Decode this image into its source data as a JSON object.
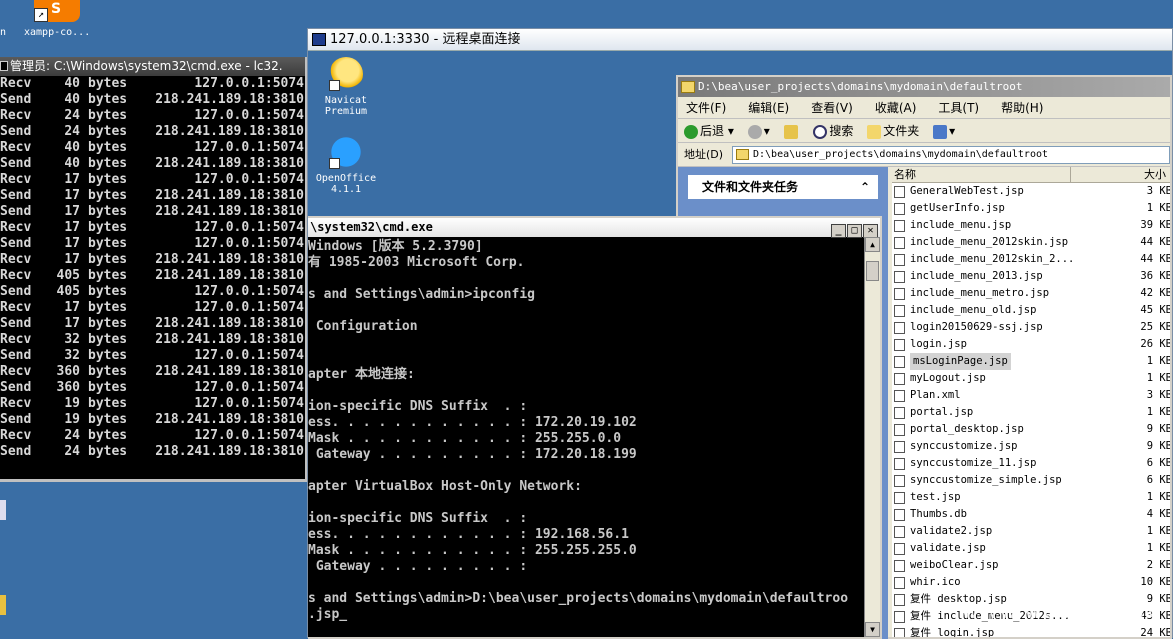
{
  "host": {
    "xampp_label": "xampp-co...",
    "left_fragment": "n",
    "xampp_logo_text": "S"
  },
  "left_cmd": {
    "title": "管理员: C:\\Windows\\system32\\cmd.exe - lc32.",
    "rows": [
      {
        "dir": "Recv",
        "num": "40",
        "unit": "bytes",
        "addr": "127.0.0.1:5074"
      },
      {
        "dir": "Send",
        "num": "40",
        "unit": "bytes",
        "addr": "218.241.189.18:3810"
      },
      {
        "dir": "Recv",
        "num": "24",
        "unit": "bytes",
        "addr": "127.0.0.1:5074"
      },
      {
        "dir": "Send",
        "num": "24",
        "unit": "bytes",
        "addr": "218.241.189.18:3810"
      },
      {
        "dir": "Recv",
        "num": "40",
        "unit": "bytes",
        "addr": "127.0.0.1:5074"
      },
      {
        "dir": "Send",
        "num": "40",
        "unit": "bytes",
        "addr": "218.241.189.18:3810"
      },
      {
        "dir": "Recv",
        "num": "17",
        "unit": "bytes",
        "addr": "127.0.0.1:5074"
      },
      {
        "dir": "Send",
        "num": "17",
        "unit": "bytes",
        "addr": "218.241.189.18:3810"
      },
      {
        "dir": "Send",
        "num": "17",
        "unit": "bytes",
        "addr": "218.241.189.18:3810"
      },
      {
        "dir": "Recv",
        "num": "17",
        "unit": "bytes",
        "addr": "127.0.0.1:5074"
      },
      {
        "dir": "Send",
        "num": "17",
        "unit": "bytes",
        "addr": "127.0.0.1:5074"
      },
      {
        "dir": "Recv",
        "num": "17",
        "unit": "bytes",
        "addr": "218.241.189.18:3810"
      },
      {
        "dir": "Recv",
        "num": "405",
        "unit": "bytes",
        "addr": "218.241.189.18:3810"
      },
      {
        "dir": "Send",
        "num": "405",
        "unit": "bytes",
        "addr": "127.0.0.1:5074"
      },
      {
        "dir": "Recv",
        "num": "17",
        "unit": "bytes",
        "addr": "127.0.0.1:5074"
      },
      {
        "dir": "Send",
        "num": "17",
        "unit": "bytes",
        "addr": "218.241.189.18:3810"
      },
      {
        "dir": "Recv",
        "num": "32",
        "unit": "bytes",
        "addr": "218.241.189.18:3810"
      },
      {
        "dir": "Send",
        "num": "32",
        "unit": "bytes",
        "addr": "127.0.0.1:5074"
      },
      {
        "dir": "Recv",
        "num": "360",
        "unit": "bytes",
        "addr": "218.241.189.18:3810"
      },
      {
        "dir": "Send",
        "num": "360",
        "unit": "bytes",
        "addr": "127.0.0.1:5074"
      },
      {
        "dir": "Recv",
        "num": "19",
        "unit": "bytes",
        "addr": "127.0.0.1:5074"
      },
      {
        "dir": "Send",
        "num": "19",
        "unit": "bytes",
        "addr": "218.241.189.18:3810"
      },
      {
        "dir": "Recv",
        "num": "24",
        "unit": "bytes",
        "addr": "127.0.0.1:5074"
      },
      {
        "dir": "Send",
        "num": "24",
        "unit": "bytes",
        "addr": "218.241.189.18:3810"
      }
    ]
  },
  "rdp": {
    "title": "127.0.0.1:3330 - 远程桌面连接",
    "icons": {
      "navicat": {
        "line1": "Navicat",
        "line2": "Premium"
      },
      "openoffice": {
        "line1": "OpenOffice",
        "line2": "4.1.1"
      }
    }
  },
  "explorer": {
    "title": "D:\\bea\\user_projects\\domains\\mydomain\\defaultroot",
    "menu": [
      "文件(F)",
      "编辑(E)",
      "查看(V)",
      "收藏(A)",
      "工具(T)",
      "帮助(H)"
    ],
    "toolbar": {
      "back": "后退",
      "search": "搜索",
      "folders": "文件夹"
    },
    "address_label": "地址(D)",
    "address_value": "D:\\bea\\user_projects\\domains\\mydomain\\defaultroot",
    "task_header": "文件和文件夹任务",
    "task_chevron": "⌃",
    "col_name": "名称",
    "col_size": "大小",
    "files": [
      {
        "name": "GeneralWebTest.jsp",
        "size": "3 KB"
      },
      {
        "name": "getUserInfo.jsp",
        "size": "1 KB"
      },
      {
        "name": "include_menu.jsp",
        "size": "39 KB"
      },
      {
        "name": "include_menu_2012skin.jsp",
        "size": "44 KB"
      },
      {
        "name": "include_menu_2012skin_2...",
        "size": "44 KB"
      },
      {
        "name": "include_menu_2013.jsp",
        "size": "36 KB"
      },
      {
        "name": "include_menu_metro.jsp",
        "size": "42 KB"
      },
      {
        "name": "include_menu_old.jsp",
        "size": "45 KB"
      },
      {
        "name": "login20150629-ssj.jsp",
        "size": "25 KB"
      },
      {
        "name": "login.jsp",
        "size": "26 KB"
      },
      {
        "name": "msLoginPage.jsp",
        "size": "1 KB"
      },
      {
        "name": "myLogout.jsp",
        "size": "1 KB"
      },
      {
        "name": "Plan.xml",
        "size": "3 KB"
      },
      {
        "name": "portal.jsp",
        "size": "1 KB"
      },
      {
        "name": "portal_desktop.jsp",
        "size": "9 KB"
      },
      {
        "name": "synccustomize.jsp",
        "size": "9 KB"
      },
      {
        "name": "synccustomize_11.jsp",
        "size": "6 KB"
      },
      {
        "name": "synccustomize_simple.jsp",
        "size": "6 KB"
      },
      {
        "name": "test.jsp",
        "size": "1 KB"
      },
      {
        "name": "Thumbs.db",
        "size": "4 KB"
      },
      {
        "name": "validate2.jsp",
        "size": "1 KB"
      },
      {
        "name": "validate.jsp",
        "size": "1 KB"
      },
      {
        "name": "weiboClear.jsp",
        "size": "2 KB"
      },
      {
        "name": "whir.ico",
        "size": "10 KB"
      },
      {
        "name": "复件 desktop.jsp",
        "size": "9 KB"
      },
      {
        "name": "复件 include_menu_2012s...",
        "size": "43 KB"
      },
      {
        "name": "复件 login.jsp",
        "size": "24 KB"
      }
    ]
  },
  "inner_cmd": {
    "title": "\\system32\\cmd.exe",
    "lines": [
      "Windows [版本 5.2.3790]",
      "有 1985-2003 Microsoft Corp.",
      "",
      "s and Settings\\admin>ipconfig",
      "",
      " Configuration",
      "",
      "",
      "apter 本地连接:",
      "",
      "ion-specific DNS Suffix  . :",
      "ess. . . . . . . . . . . . : 172.20.19.102",
      "Mask . . . . . . . . . . . : 255.255.0.0",
      " Gateway . . . . . . . . . : 172.20.18.199",
      "",
      "apter VirtualBox Host-Only Network:",
      "",
      "ion-specific DNS Suffix  . :",
      "ess. . . . . . . . . . . . : 192.168.56.1",
      "Mask . . . . . . . . . . . : 255.255.255.0",
      " Gateway . . . . . . . . . :",
      "",
      "s and Settings\\admin>D:\\bea\\user_projects\\domains\\mydomain\\defaultroo",
      ".jsp_"
    ]
  },
  "watermark": "www.wooyun.org"
}
